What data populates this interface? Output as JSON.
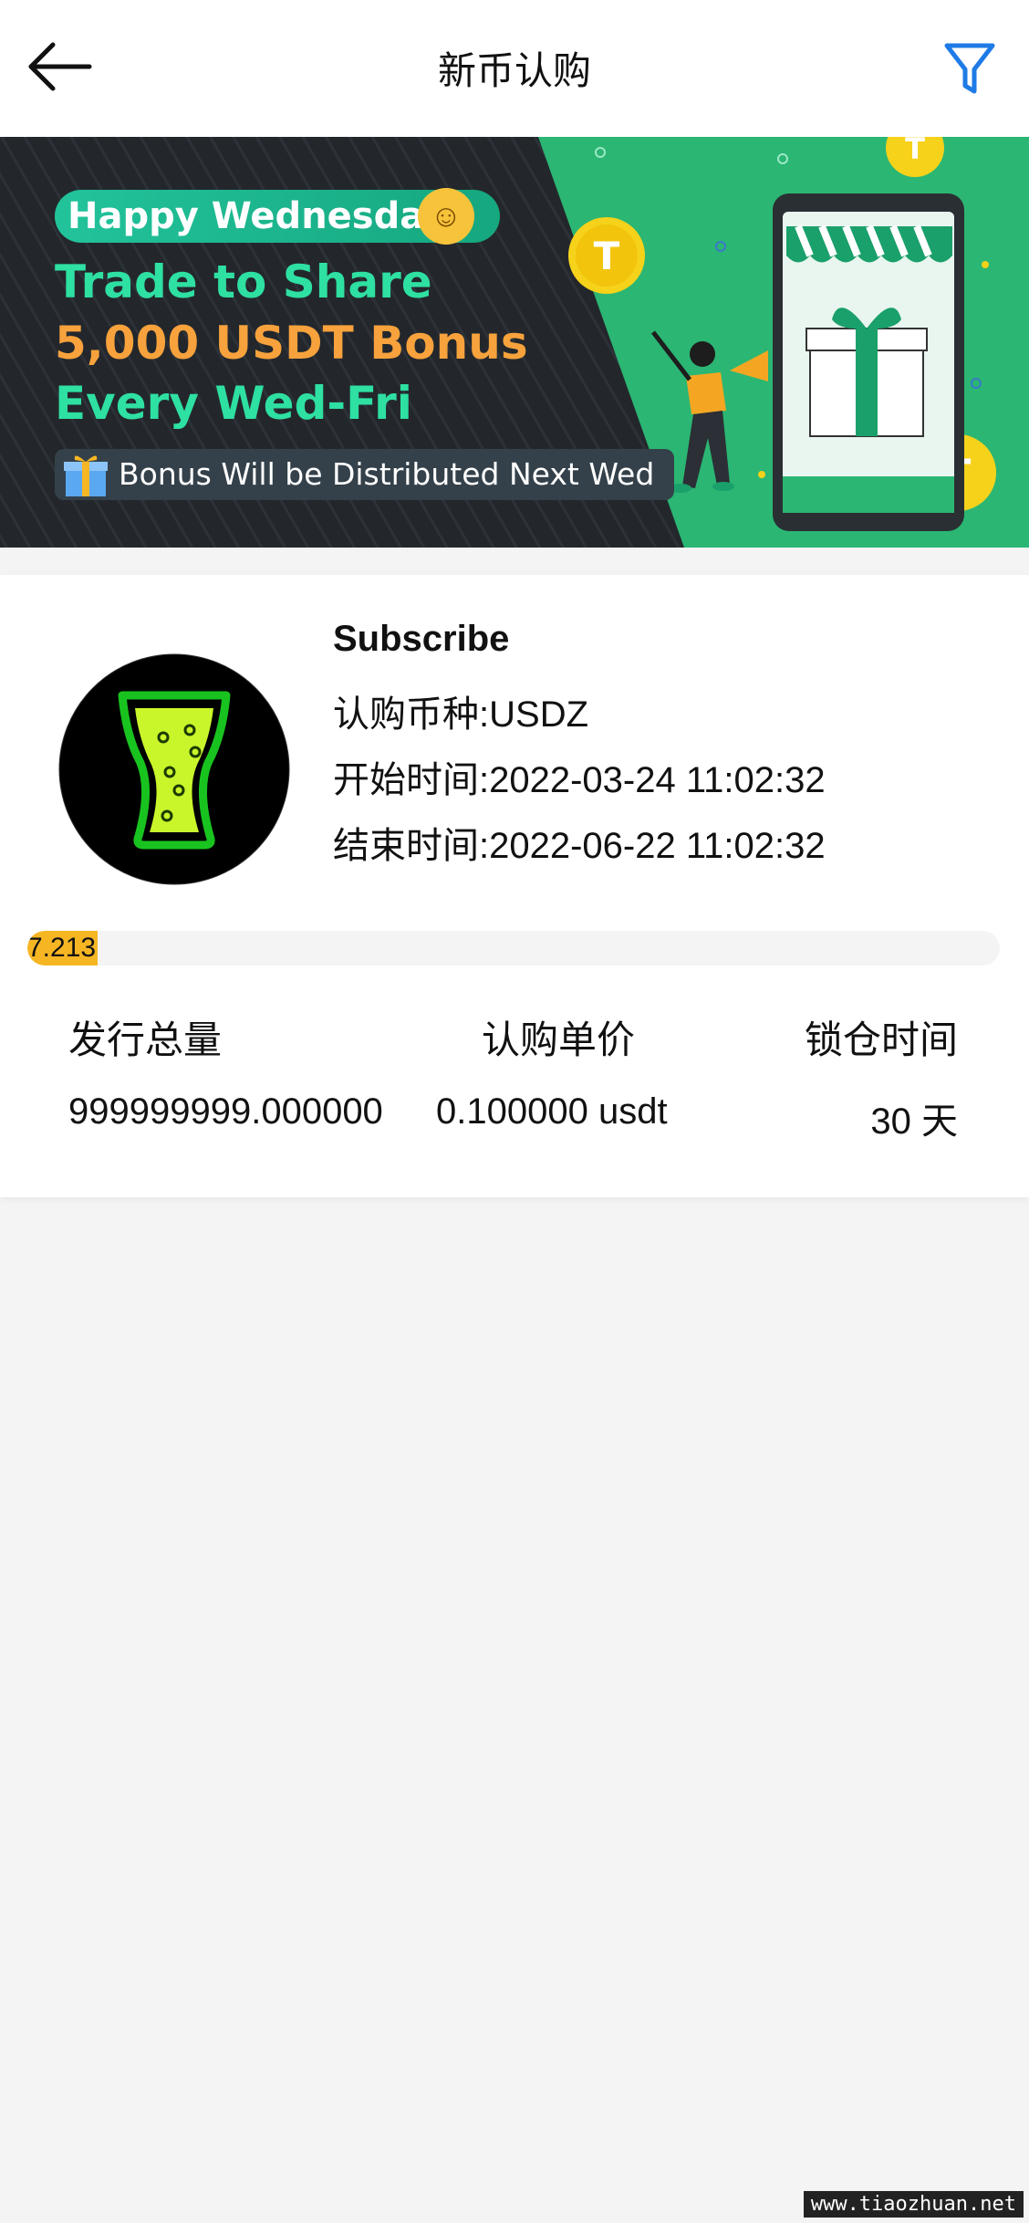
{
  "header": {
    "title": "新币认购",
    "back_icon": "arrow-left-icon",
    "filter_icon": "filter-icon",
    "accent_color": "#1e7be6"
  },
  "banner": {
    "happy_text": "Happy Wednesday!",
    "line1": "Trade to Share",
    "line2": "5,000 USDT Bonus",
    "line3": "Every Wed-Fri",
    "bonus_text": "Bonus Will be Distributed Next Wed",
    "colors": {
      "dark_bg": "#23272c",
      "green_bg": "#2bb673",
      "highlight": "#2ee0a2",
      "orange": "#f7a23c"
    }
  },
  "subscription": {
    "title": "Subscribe",
    "currency_label": "认购币种:",
    "currency_value": "USDZ",
    "start_label": "开始时间:",
    "start_value": "2022-03-24 11:02:32",
    "end_label": "结束时间:",
    "end_value": "2022-06-22 11:02:32",
    "progress_text": "7.213",
    "progress_percent": 7.213,
    "progress_color": "#f6b624",
    "columns": {
      "total_label": "发行总量",
      "total_value": "999999999.000000",
      "price_label": "认购单价",
      "price_value": "0.100000 usdt",
      "lock_label": "锁仓时间",
      "lock_value": "30 天"
    }
  },
  "watermark": "www.tiaozhuan.net"
}
